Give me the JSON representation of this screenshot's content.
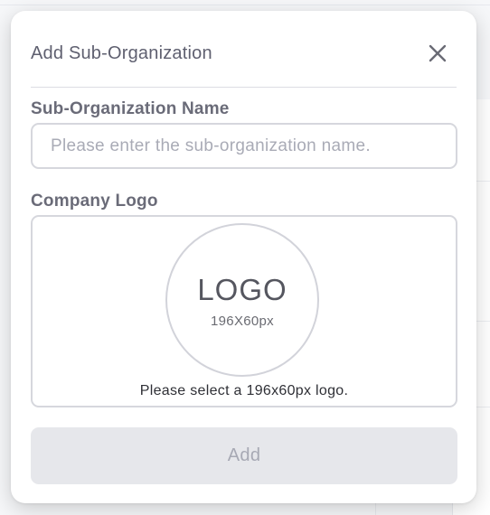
{
  "modal": {
    "title": "Add Sub-Organization",
    "close_icon": "close-icon"
  },
  "fields": {
    "name": {
      "label": "Sub-Organization Name",
      "value": "",
      "placeholder": "Please enter the sub-organization name."
    },
    "logo": {
      "label": "Company Logo",
      "placeholder_text": "LOGO",
      "placeholder_size": "196X60px",
      "hint": "Please select a 196x60px logo."
    }
  },
  "actions": {
    "add_label": "Add",
    "add_disabled": true
  },
  "colors": {
    "title": "#5f6070",
    "label": "#6a6b78",
    "border": "#d6d7dd",
    "placeholder": "#a9abb6",
    "disabled_button_bg": "#e6e7eb",
    "disabled_button_text": "#a7a9b4"
  }
}
